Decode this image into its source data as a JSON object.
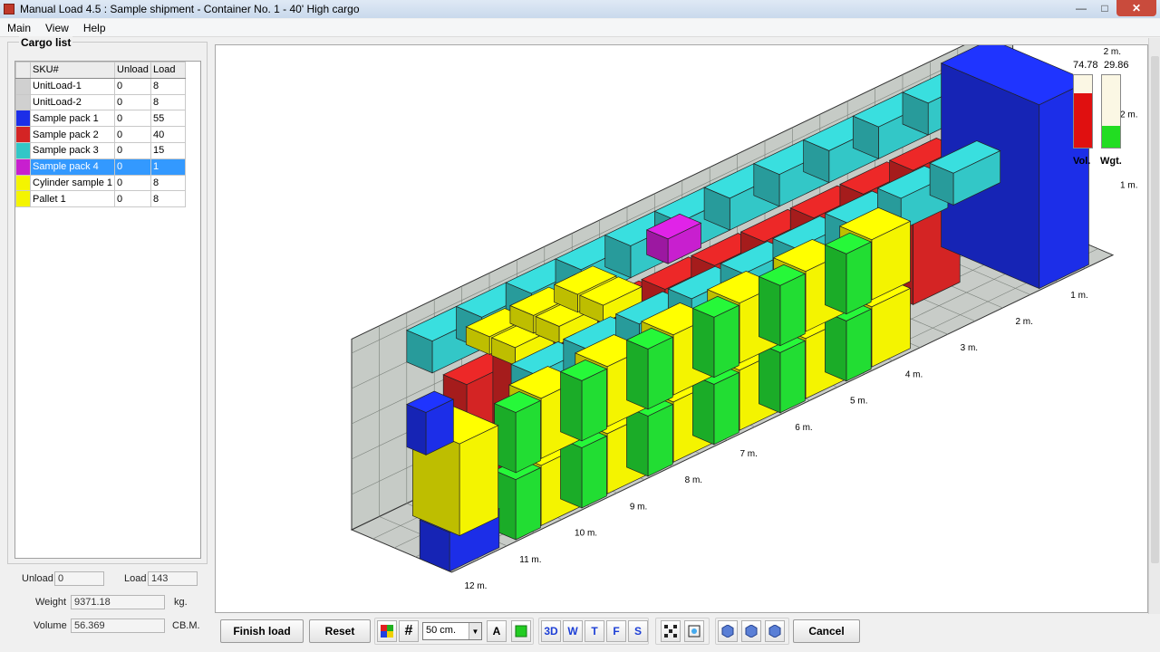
{
  "window": {
    "title": "Manual Load 4.5 : Sample shipment - Container No. 1 - 40' High cargo"
  },
  "menu": [
    "Main",
    "View",
    "Help"
  ],
  "cargo": {
    "title": "Cargo list",
    "headers": {
      "sku": "SKU#",
      "unload": "Unload",
      "load": "Load"
    },
    "items": [
      {
        "sku": "UnitLoad-1",
        "unload": "0",
        "load": "8",
        "color": "#d0d0d0"
      },
      {
        "sku": "UnitLoad-2",
        "unload": "0",
        "load": "8",
        "color": "#d0d0d0"
      },
      {
        "sku": "Sample pack 1",
        "unload": "0",
        "load": "55",
        "color": "#1c2ee8"
      },
      {
        "sku": "Sample pack 2",
        "unload": "0",
        "load": "40",
        "color": "#d42424"
      },
      {
        "sku": "Sample pack 3",
        "unload": "0",
        "load": "15",
        "color": "#33c7c7"
      },
      {
        "sku": "Sample pack 4",
        "unload": "0",
        "load": "1",
        "color": "#c81fcf",
        "selected": true
      },
      {
        "sku": "Cylinder sample 1",
        "unload": "0",
        "load": "8",
        "color": "#f4f400"
      },
      {
        "sku": "Pallet 1",
        "unload": "0",
        "load": "8",
        "color": "#f4f400"
      }
    ]
  },
  "stats": {
    "unload_label": "Unload",
    "unload_value": "0",
    "load_label": "Load",
    "load_value": "143",
    "weight_label": "Weight",
    "weight_value": "9371.18",
    "weight_unit": "kg.",
    "volume_label": "Volume",
    "volume_value": "56.369",
    "volume_unit": "CB.M."
  },
  "gauges": {
    "vol": {
      "value": "74.78",
      "label": "Vol.",
      "fraction": 0.7478,
      "color": "#e01010"
    },
    "wgt": {
      "value": "29.86",
      "label": "Wgt.",
      "fraction": 0.2986,
      "color": "#22dd22"
    }
  },
  "container": {
    "length_labels": [
      "1 m.",
      "2 m.",
      "3 m.",
      "4 m.",
      "5 m.",
      "6 m.",
      "7 m.",
      "8 m.",
      "9 m.",
      "10 m.",
      "11 m.",
      "12 m."
    ],
    "width_labels": [
      "1 m.",
      "2 m."
    ],
    "height_labels": [
      "2 m.",
      "1 m."
    ]
  },
  "toolbar": {
    "finish_label": "Finish load",
    "reset_label": "Reset",
    "grid_size": "50 cm.",
    "text_btn": "A",
    "view_3d": "3D",
    "view_w": "W",
    "view_t": "T",
    "view_f": "F",
    "view_s": "S",
    "cancel_label": "Cancel"
  }
}
